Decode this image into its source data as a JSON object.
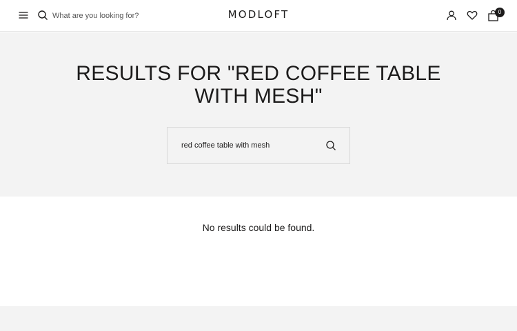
{
  "header": {
    "search_placeholder": "What are you looking for?",
    "logo": "MODLOFT",
    "cart_count": "0",
    "icons": {
      "menu": "hamburger-menu-icon",
      "search": "search-icon",
      "account": "user-icon",
      "wishlist": "heart-icon",
      "cart": "shopping-bag-icon"
    }
  },
  "search_results": {
    "title": "RESULTS FOR \"RED COFFEE TABLE WITH MESH\"",
    "query_value": "red coffee table with mesh",
    "submit_icon": "search-icon",
    "empty_message": "No results could be found."
  },
  "colors": {
    "text": "#1c1b1b",
    "hero_background": "#f3f3f3",
    "page_background": "#ffffff"
  }
}
